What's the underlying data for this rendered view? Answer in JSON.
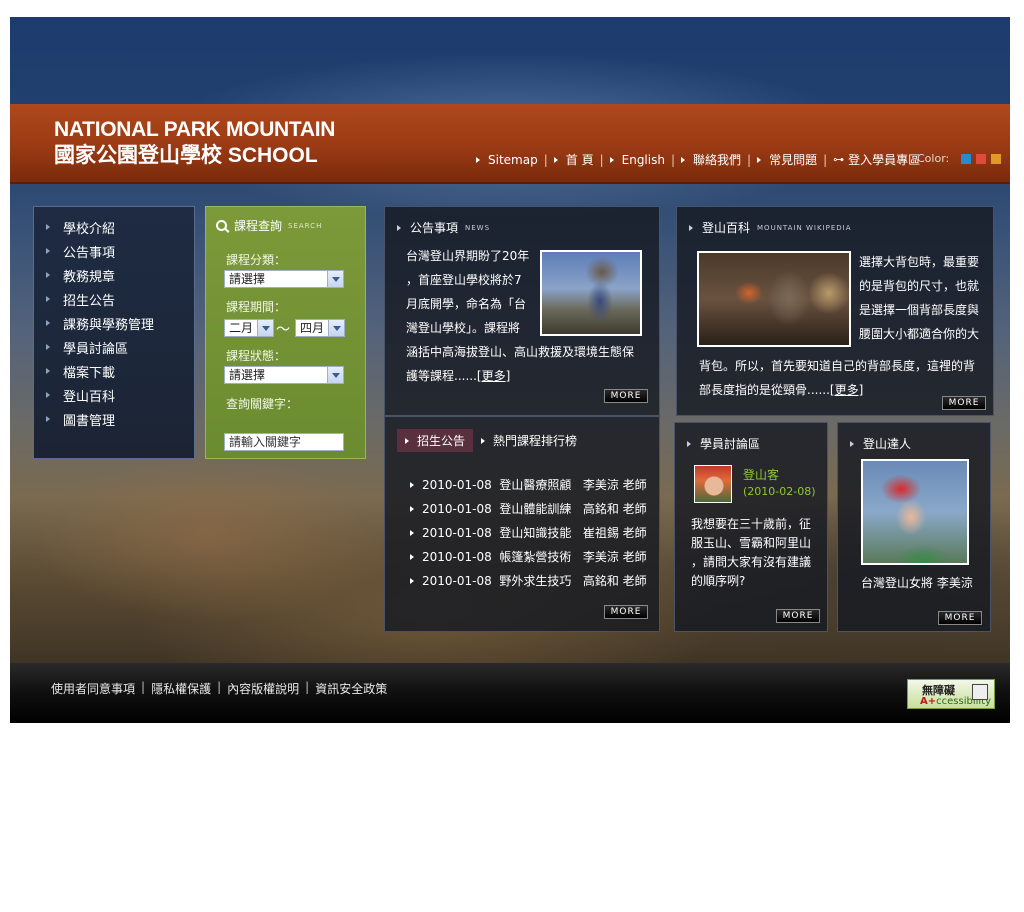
{
  "header": {
    "logo_en": "NATIONAL PARK MOUNTAIN",
    "logo_zh": "國家公園登山學校",
    "logo_school": "SCHOOL",
    "nav": [
      "Sitemap",
      "首 頁",
      "English",
      "聯絡我們",
      "常見問題",
      "登入學員專區"
    ],
    "color_label": "Color:",
    "color_swatches": [
      "#2a8ad0",
      "#e04a3a",
      "#e09a20"
    ]
  },
  "sidebar": {
    "items": [
      "學校介紹",
      "公告事項",
      "教務規章",
      "招生公告",
      "課務與學務管理",
      "學員討論區",
      "檔案下載",
      "登山百科",
      "圖書管理"
    ]
  },
  "search": {
    "title": "課程查詢",
    "subtitle": "SEARCH",
    "category_label": "課程分類：",
    "category_value": "請選擇",
    "period_label": "課程期間：",
    "period_from": "二月",
    "period_to": "四月",
    "period_sep": "～",
    "status_label": "課程狀態：",
    "status_value": "請選擇",
    "keyword_label": "查詢關鍵字：",
    "keyword_placeholder": "請輸入關鍵字"
  },
  "announcements": {
    "title": "公告事項",
    "subtitle": "NEWS",
    "lines": [
      "台灣登山界期盼了20年",
      "，首座登山學校將於7",
      "月底開學，命名為「台",
      "灣登山學校」。課程將",
      "涵括中高海拔登山、高山救援及環境生態保",
      "護等課程......"
    ],
    "more_link": "[更多]",
    "more_button": "MORE"
  },
  "wiki": {
    "title": "登山百科",
    "subtitle": "MOUNTAIN WIKIPEDIA",
    "lines_right": [
      "選擇大背包時，最重要",
      "的是背包的尺寸，也就",
      "是選擇一個背部長度與",
      "腰圍大小都適合你的大"
    ],
    "lines_full": [
      "背包。所以，首先要知道自己的背部長度，這裡的背",
      "部長度指的是從頸骨......"
    ],
    "more_link": "[更多]",
    "more_button": "MORE"
  },
  "enroll": {
    "tab_active": "招生公告",
    "tab_other": "熱門課程排行榜",
    "rows": [
      {
        "date": "2010-01-08",
        "course": "登山醫療照顧",
        "teacher": "李美涼 老師"
      },
      {
        "date": "2010-01-08",
        "course": "登山體能訓練",
        "teacher": "高銘和 老師"
      },
      {
        "date": "2010-01-08",
        "course": "登山知識技能",
        "teacher": "崔祖錫 老師"
      },
      {
        "date": "2010-01-08",
        "course": "帳篷紮營技術",
        "teacher": "李美涼 老師"
      },
      {
        "date": "2010-01-08",
        "course": "野外求生技巧",
        "teacher": "高銘和 老師"
      }
    ],
    "more_button": "MORE"
  },
  "forum": {
    "title": "學員討論區",
    "user": "登山客",
    "date": "(2010-02-08)",
    "lines": [
      "我想要在三十歲前，征",
      "服玉山、雪霸和阿里山",
      "，請問大家有沒有建議",
      "的順序咧?"
    ],
    "more_button": "MORE"
  },
  "expert": {
    "title": "登山達人",
    "caption": "台灣登山女將 李美涼",
    "more_button": "MORE"
  },
  "footer": {
    "links": [
      "使用者同意事項",
      "隱私權保護",
      "內容版權說明",
      "資訊安全政策"
    ],
    "badge_line1": "無障礙",
    "badge_line2_a": "A+",
    "badge_line2_b": "ccessibility"
  }
}
